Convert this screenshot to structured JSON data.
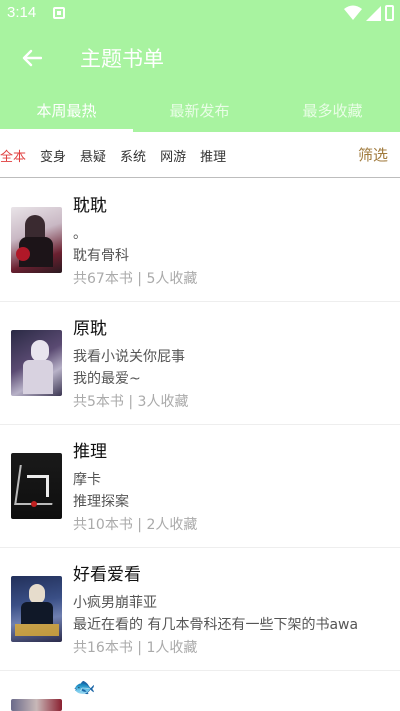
{
  "status_bar": {
    "time": "3:14"
  },
  "toolbar": {
    "title": "主题书单",
    "back_icon": "arrow-left-icon"
  },
  "tabs": [
    {
      "label": "本周最热",
      "active": true
    },
    {
      "label": "最新发布",
      "active": false
    },
    {
      "label": "最多收藏",
      "active": false
    }
  ],
  "filters": {
    "chips": [
      "全本",
      "变身",
      "悬疑",
      "系统",
      "网游",
      "推理"
    ],
    "active_chip": "全本",
    "filter_label": "筛选"
  },
  "booklists": [
    {
      "title": "耽耽",
      "author": "。",
      "description": "耽有骨科",
      "book_count": "共67本书",
      "favorites": "5人收藏"
    },
    {
      "title": "原耽",
      "author": "我看小说关你屁事",
      "description": "我的最爱~",
      "book_count": "共5本书",
      "favorites": "3人收藏"
    },
    {
      "title": "推理",
      "author": "摩卡",
      "description": "推理探案",
      "book_count": "共10本书",
      "favorites": "2人收藏"
    },
    {
      "title": "好看爱看",
      "author": "小疯男崩菲亚",
      "description": "最近在看的 有几本骨科还有一些下架的书awa",
      "book_count": "共16本书",
      "favorites": "1人收藏"
    },
    {
      "title": "🐟",
      "author": "",
      "description": "",
      "book_count": "",
      "favorites": ""
    }
  ],
  "colors": {
    "header": "#a8f3a0",
    "active_chip": "#e04040",
    "filter": "#a07a3c"
  }
}
